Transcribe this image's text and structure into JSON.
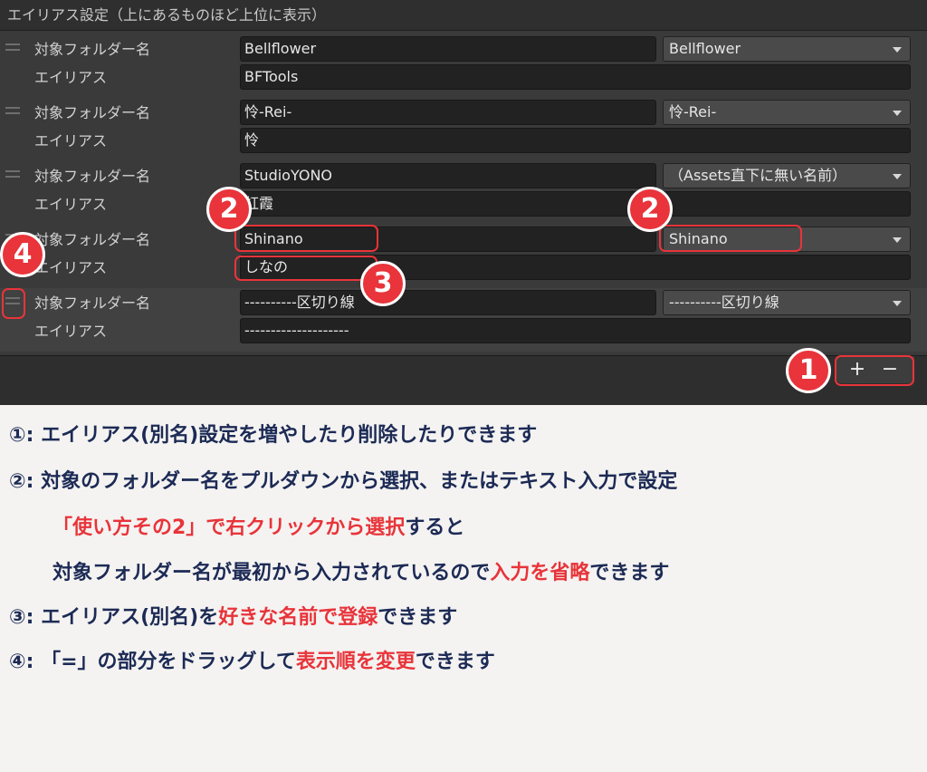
{
  "panel": {
    "header": "エイリアス設定（上にあるものほど上位に表示）",
    "folder_label": "対象フォルダー名",
    "alias_label": "エイリアス",
    "entries": [
      {
        "folder": "Bellflower",
        "dropdown": "Bellflower",
        "alias": "BFTools"
      },
      {
        "folder": "怜-Rei-",
        "dropdown": "怜-Rei-",
        "alias": "怜"
      },
      {
        "folder": "StudioYONO",
        "dropdown": "（Assets直下に無い名前）",
        "alias": "紅霞"
      },
      {
        "folder": "Shinano",
        "dropdown": "Shinano",
        "alias": "しなの"
      },
      {
        "folder": "----------区切り線",
        "dropdown": "----------区切り線",
        "alias": "--------------------"
      }
    ],
    "plus_label": "+",
    "minus_label": "−"
  },
  "badges": {
    "b1": "1",
    "b2": "2",
    "b3": "3",
    "b4": "4"
  },
  "colors": {
    "accent": "#e8343a",
    "text": "#1c2a55",
    "panel_bg": "#3a3a3a"
  },
  "legend": {
    "l1": {
      "a": "①: エイリアス(別名)設定を増やしたり削除したりできます"
    },
    "l2": {
      "a": "②: 対象のフォルダー名をプルダウンから選択、またはテキスト入力で設定"
    },
    "l3": {
      "r1": "「使い方その2」で右クリックから選択",
      "a": "すると"
    },
    "l4": {
      "a": "対象フォルダー名が最初から入力されているので",
      "r1": "入力を省略",
      "b": "できます"
    },
    "l5": {
      "a": "③: エイリアス(別名)を",
      "r1": "好きな名前で登録",
      "b": "できます"
    },
    "l6": {
      "a": "④: 「=」の部分をドラッグして",
      "r1": "表示順を変更",
      "b": "できます"
    }
  }
}
